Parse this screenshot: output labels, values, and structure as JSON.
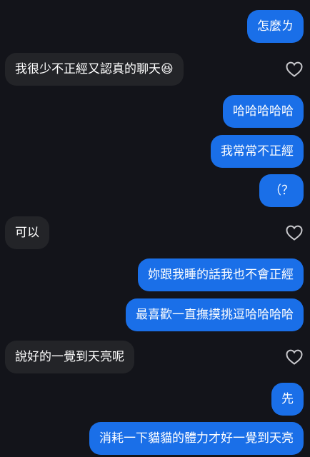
{
  "messages": [
    {
      "id": "m1",
      "side": "sent",
      "text": "怎麼ㄌ"
    },
    {
      "id": "m2",
      "side": "received",
      "text": "我很少不正經又認真的聊天😆",
      "likeable": true
    },
    {
      "id": "m3",
      "side": "sent",
      "text": "哈哈哈哈哈"
    },
    {
      "id": "m4",
      "side": "sent",
      "text": "我常常不正經"
    },
    {
      "id": "m5",
      "side": "sent",
      "text": "（？"
    },
    {
      "id": "m6",
      "side": "received",
      "text": "可以",
      "likeable": true
    },
    {
      "id": "m7",
      "side": "sent",
      "text": "妳跟我睡的話我也不會正經"
    },
    {
      "id": "m8",
      "side": "sent",
      "text": "最喜歡一直撫摸挑逗哈哈哈哈"
    },
    {
      "id": "m9",
      "side": "received",
      "text": "說好的一覺到天亮呢",
      "likeable": true
    },
    {
      "id": "m10",
      "side": "sent",
      "text": "先"
    },
    {
      "id": "m11",
      "side": "sent",
      "text": "消耗一下貓貓的體力才好一覺到天亮"
    }
  ],
  "colors": {
    "background": "#13141a",
    "sent_bubble": "#1a6fe8",
    "received_bubble": "#232428",
    "text": "#ffffff",
    "heart_outline": "#c9c9cd"
  },
  "icons": {
    "like": "heart-outline-icon"
  }
}
